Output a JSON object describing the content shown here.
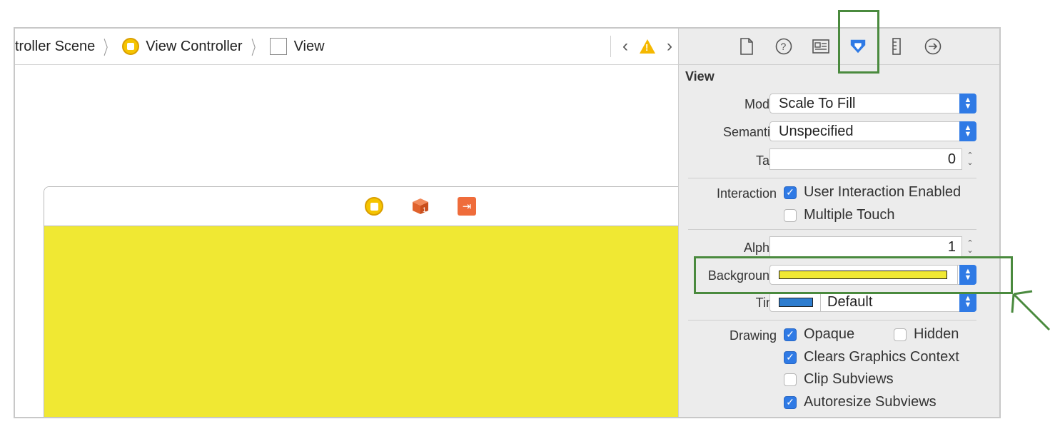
{
  "breadcrumb": {
    "items": [
      "troller Scene",
      "View Controller",
      "View"
    ]
  },
  "inspector": {
    "section_title": "View",
    "mode": {
      "label": "Mode",
      "value": "Scale To Fill"
    },
    "semantic": {
      "label": "Semantic",
      "value": "Unspecified"
    },
    "tag": {
      "label": "Tag",
      "value": "0"
    },
    "interaction": {
      "label": "Interaction",
      "user_interaction_enabled": {
        "label": "User Interaction Enabled",
        "checked": true
      },
      "multiple_touch": {
        "label": "Multiple Touch",
        "checked": false
      }
    },
    "alpha": {
      "label": "Alpha",
      "value": "1"
    },
    "background": {
      "label": "Background",
      "color": "#f0e833"
    },
    "tint": {
      "label": "Tint",
      "value": "Default",
      "color": "#2e7dcf"
    },
    "drawing": {
      "label": "Drawing",
      "opaque": {
        "label": "Opaque",
        "checked": true
      },
      "hidden": {
        "label": "Hidden",
        "checked": false
      },
      "clears_graphics_context": {
        "label": "Clears Graphics Context",
        "checked": true
      },
      "clip_subviews": {
        "label": "Clip Subviews",
        "checked": false
      },
      "autoresize_subviews": {
        "label": "Autoresize Subviews",
        "checked": true
      }
    }
  },
  "canvas": {
    "view_background": "#f0e833"
  },
  "colors": {
    "accent": "#2f7ae5",
    "annotation": "#4a8a3e"
  }
}
